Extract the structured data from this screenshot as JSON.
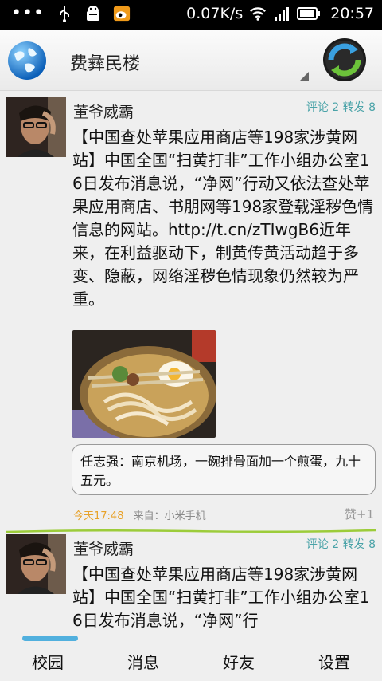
{
  "statusbar": {
    "dots": "•••",
    "speed": "0.07K/s",
    "time": "20:57",
    "icons": [
      "usb-icon",
      "android-debug-icon",
      "weibo-notification-icon",
      "wifi-icon",
      "signal-icon",
      "battery-icon"
    ]
  },
  "header": {
    "title": "费彝民楼",
    "icons": [
      "globe-icon",
      "refresh-icon"
    ]
  },
  "feed": {
    "posts": [
      {
        "username": "董爷威霸",
        "counts": "评论 2 转发 8",
        "text": "【中国查处苹果应用商店等198家涉黄网站】中国全国“扫黄打非”工作小组办公室16日发布消息说，“净网”行动又依法查处苹果应用商店、书朋网等198家登载淫秽色情信息的网站。http://t.cn/zTIwgB6近年来，在利益驱动下，制黄传黄活动趋于多变、隐蔽，网络淫秽色情现象仍然较为严重。",
        "retweet": "任志强：南京机场，一碗排骨面加一个煎蛋，九十五元。",
        "time": "今天17:48",
        "source": "来自：小米手机",
        "like": "赞+1"
      },
      {
        "username": "董爷威霸",
        "counts": "评论 2 转发 8",
        "text": "【中国查处苹果应用商店等198家涉黄网站】中国全国“扫黄打非”工作小组办公室16日发布消息说，“净网”行"
      }
    ]
  },
  "tabs": [
    "校园",
    "消息",
    "好友",
    "设置"
  ],
  "colors": {
    "accent_time": "#e8a22a",
    "counts": "#4aa3a8",
    "divider": "#9ccc3a"
  }
}
